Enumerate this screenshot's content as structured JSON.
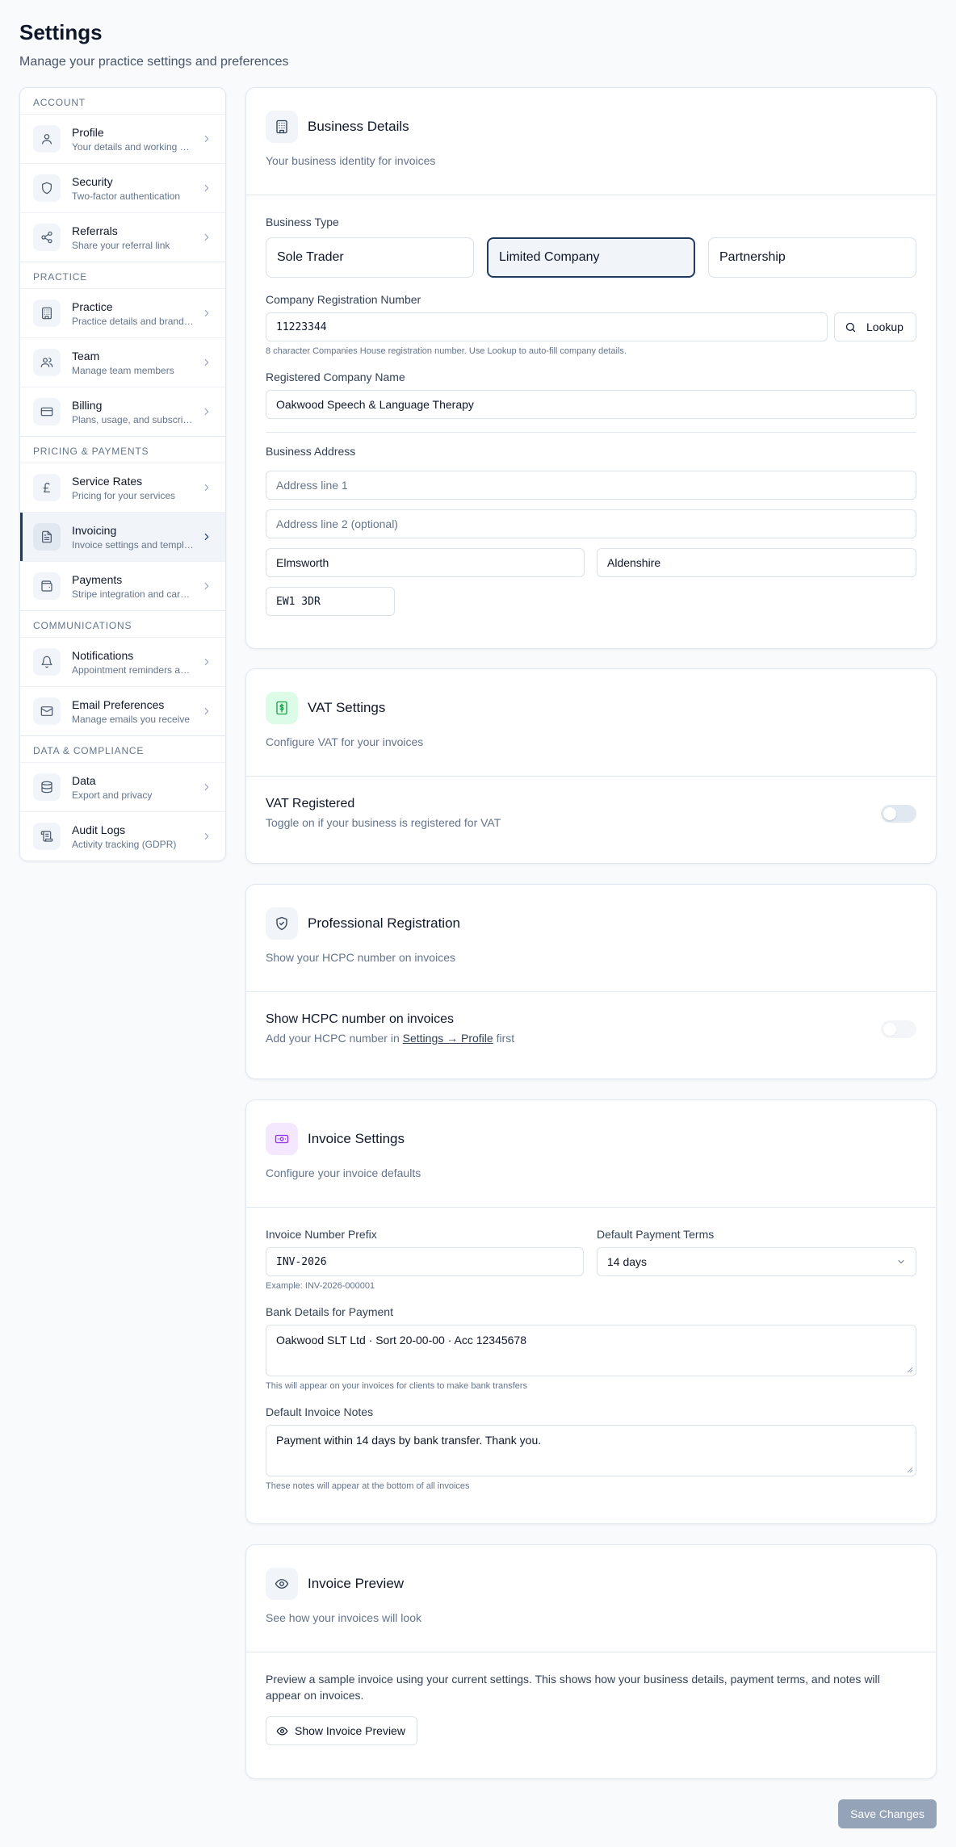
{
  "header": {
    "title": "Settings",
    "subtitle": "Manage your practice settings and preferences"
  },
  "sidebar": {
    "sections": [
      {
        "label": "ACCOUNT",
        "items": [
          {
            "title": "Profile",
            "desc": "Your details and working hours",
            "icon": "user-icon"
          },
          {
            "title": "Security",
            "desc": "Two-factor authentication",
            "icon": "shield-icon"
          },
          {
            "title": "Referrals",
            "desc": "Share your referral link",
            "icon": "share-icon"
          }
        ]
      },
      {
        "label": "PRACTICE",
        "items": [
          {
            "title": "Practice",
            "desc": "Practice details and branding",
            "icon": "building-icon"
          },
          {
            "title": "Team",
            "desc": "Manage team members",
            "icon": "users-icon"
          },
          {
            "title": "Billing",
            "desc": "Plans, usage, and subscription",
            "icon": "card-icon"
          }
        ]
      },
      {
        "label": "PRICING & PAYMENTS",
        "items": [
          {
            "title": "Service Rates",
            "desc": "Pricing for your services",
            "icon": "pound-icon"
          },
          {
            "title": "Invoicing",
            "desc": "Invoice settings and templates",
            "icon": "document-icon",
            "active": true
          },
          {
            "title": "Payments",
            "desc": "Stripe integration and card payments",
            "icon": "wallet-icon"
          }
        ]
      },
      {
        "label": "COMMUNICATIONS",
        "items": [
          {
            "title": "Notifications",
            "desc": "Appointment reminders and alerts",
            "icon": "bell-icon"
          },
          {
            "title": "Email Preferences",
            "desc": "Manage emails you receive",
            "icon": "mail-icon"
          }
        ]
      },
      {
        "label": "DATA & COMPLIANCE",
        "items": [
          {
            "title": "Data",
            "desc": "Export and privacy",
            "icon": "database-icon"
          },
          {
            "title": "Audit Logs",
            "desc": "Activity tracking (GDPR)",
            "icon": "scroll-icon"
          }
        ]
      }
    ]
  },
  "business": {
    "title": "Business Details",
    "desc": "Your business identity for invoices",
    "type_label": "Business Type",
    "types": [
      "Sole Trader",
      "Limited Company",
      "Partnership"
    ],
    "selected_type": "Limited Company",
    "reg_label": "Company Registration Number",
    "reg_value": "11223344",
    "lookup_label": "Lookup",
    "reg_hint": "8 character Companies House registration number. Use Lookup to auto-fill company details.",
    "name_label": "Registered Company Name",
    "name_value": "Oakwood Speech & Language Therapy",
    "address_label": "Business Address",
    "address1_placeholder": "Address line 1",
    "address2_placeholder": "Address line 2 (optional)",
    "city": "Elmsworth",
    "county": "Aldenshire",
    "postcode": "EW1 3DR"
  },
  "vat": {
    "title": "VAT Settings",
    "desc": "Configure VAT for your invoices",
    "row_title": "VAT Registered",
    "row_desc": "Toggle on if your business is registered for VAT",
    "enabled": false
  },
  "professional": {
    "title": "Professional Registration",
    "desc": "Show your HCPC number on invoices",
    "row_title": "Show HCPC number on invoices",
    "row_desc_prefix": "Add your HCPC number in ",
    "row_desc_link": "Settings → Profile",
    "row_desc_suffix": " first",
    "enabled": false
  },
  "invoice": {
    "title": "Invoice Settings",
    "desc": "Configure your invoice defaults",
    "prefix_label": "Invoice Number Prefix",
    "prefix_value": "INV-2026",
    "prefix_hint": "Example: INV-2026-000001",
    "terms_label": "Default Payment Terms",
    "terms_value": "14 days",
    "bank_label": "Bank Details for Payment",
    "bank_value": "Oakwood SLT Ltd · Sort 20-00-00 · Acc 12345678",
    "bank_hint": "This will appear on your invoices for clients to make bank transfers",
    "notes_label": "Default Invoice Notes",
    "notes_value": "Payment within 14 days by bank transfer. Thank you.",
    "notes_hint": "These notes will appear at the bottom of all invoices"
  },
  "preview": {
    "title": "Invoice Preview",
    "desc": "See how your invoices will look",
    "body": "Preview a sample invoice using your current settings. This shows how your business details, payment terms, and notes will appear on invoices.",
    "button_label": "Show Invoice Preview"
  },
  "footer": {
    "save_label": "Save Changes"
  }
}
